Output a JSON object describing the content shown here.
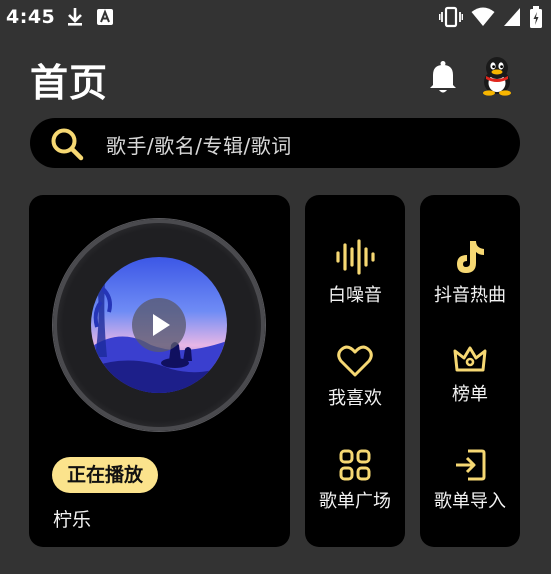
{
  "status_bar": {
    "time": "4:45",
    "icons_left": [
      "download-icon",
      "a-icon"
    ],
    "icons_right": [
      "vibrate-icon",
      "wifi-icon",
      "signal-icon",
      "battery-icon"
    ]
  },
  "header": {
    "title": "首页",
    "icons": [
      "bell-icon",
      "avatar"
    ]
  },
  "search": {
    "placeholder": "歌手/歌名/专辑/歌词"
  },
  "player": {
    "badge": "正在播放",
    "track": "柠乐"
  },
  "grid": {
    "col1": [
      {
        "label": "白噪音",
        "icon": "waveform-icon"
      },
      {
        "label": "我喜欢",
        "icon": "heart-icon"
      },
      {
        "label": "歌单广场",
        "icon": "grid-icon"
      }
    ],
    "col2": [
      {
        "label": "抖音热曲",
        "icon": "tiktok-icon"
      },
      {
        "label": "榜单",
        "icon": "crown-icon"
      },
      {
        "label": "歌单导入",
        "icon": "import-icon"
      }
    ]
  },
  "colors": {
    "background": "#333333",
    "card": "#000000",
    "accent": "#fbe38c",
    "icon_accent": "#f6d873"
  }
}
